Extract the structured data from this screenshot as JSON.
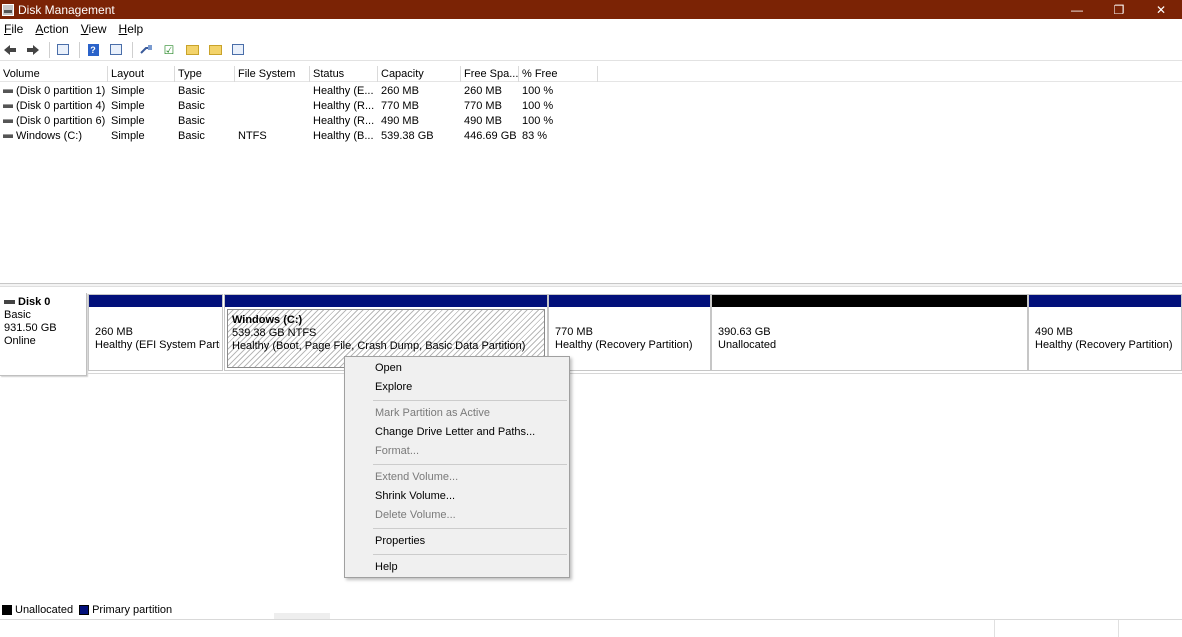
{
  "window": {
    "title": "Disk Management",
    "controls": {
      "minimize": "—",
      "restore": "❐",
      "close": "✕"
    }
  },
  "menubar": [
    {
      "label": "File",
      "accel": "F",
      "rest": "ile"
    },
    {
      "label": "Action",
      "accel": "A",
      "rest": "ction"
    },
    {
      "label": "View",
      "accel": "V",
      "rest": "iew"
    },
    {
      "label": "Help",
      "accel": "H",
      "rest": "elp"
    }
  ],
  "toolbar": {
    "icons": [
      "back-arrow-icon",
      "forward-arrow-icon",
      "console-tree-icon",
      "help-icon",
      "properties-icon",
      "connect-icon",
      "check-icon",
      "folder-up-icon",
      "folder-search-icon",
      "list-view-icon"
    ]
  },
  "volume_list": {
    "columns": [
      "Volume",
      "Layout",
      "Type",
      "File System",
      "Status",
      "Capacity",
      "Free Spa...",
      "% Free"
    ],
    "rows": [
      [
        "(Disk 0 partition 1)",
        "Simple",
        "Basic",
        "",
        "Healthy (E...",
        "260 MB",
        "260 MB",
        "100 %"
      ],
      [
        "(Disk 0 partition 4)",
        "Simple",
        "Basic",
        "",
        "Healthy (R...",
        "770 MB",
        "770 MB",
        "100 %"
      ],
      [
        "(Disk 0 partition 6)",
        "Simple",
        "Basic",
        "",
        "Healthy (R...",
        "490 MB",
        "490 MB",
        "100 %"
      ],
      [
        "Windows (C:)",
        "Simple",
        "Basic",
        "NTFS",
        "Healthy (B...",
        "539.38 GB",
        "446.69 GB",
        "83 %"
      ]
    ]
  },
  "disk": {
    "name": "Disk 0",
    "type": "Basic",
    "size": "931.50 GB",
    "status": "Online",
    "partitions": [
      {
        "name": "",
        "size": "260 MB",
        "status": "Healthy (EFI System Partition)",
        "kind": "primary"
      },
      {
        "name": "Windows  (C:)",
        "size": "539.38 GB NTFS",
        "status": "Healthy (Boot, Page File, Crash Dump, Basic Data Partition)",
        "kind": "primary",
        "selected": true
      },
      {
        "name": "",
        "size": "770 MB",
        "status": "Healthy (Recovery Partition)",
        "kind": "primary"
      },
      {
        "name": "",
        "size": "390.63 GB",
        "status": "Unallocated",
        "kind": "unallocated"
      },
      {
        "name": "",
        "size": "490 MB",
        "status": "Healthy (Recovery Partition)",
        "kind": "primary"
      }
    ]
  },
  "context_menu": {
    "open": "Open",
    "explore": "Explore",
    "mark_active": "Mark Partition as Active",
    "change_letter": "Change Drive Letter and Paths...",
    "format": "Format...",
    "extend": "Extend Volume...",
    "shrink": "Shrink Volume...",
    "delete": "Delete Volume...",
    "properties": "Properties",
    "help": "Help"
  },
  "legend": {
    "unallocated": {
      "label": "Unallocated",
      "color": "#000000"
    },
    "primary": {
      "label": "Primary partition",
      "color": "#02107a"
    }
  },
  "colors": {
    "titlebar": "#7b2305",
    "primary": "#02107a",
    "unallocated": "#000000"
  }
}
